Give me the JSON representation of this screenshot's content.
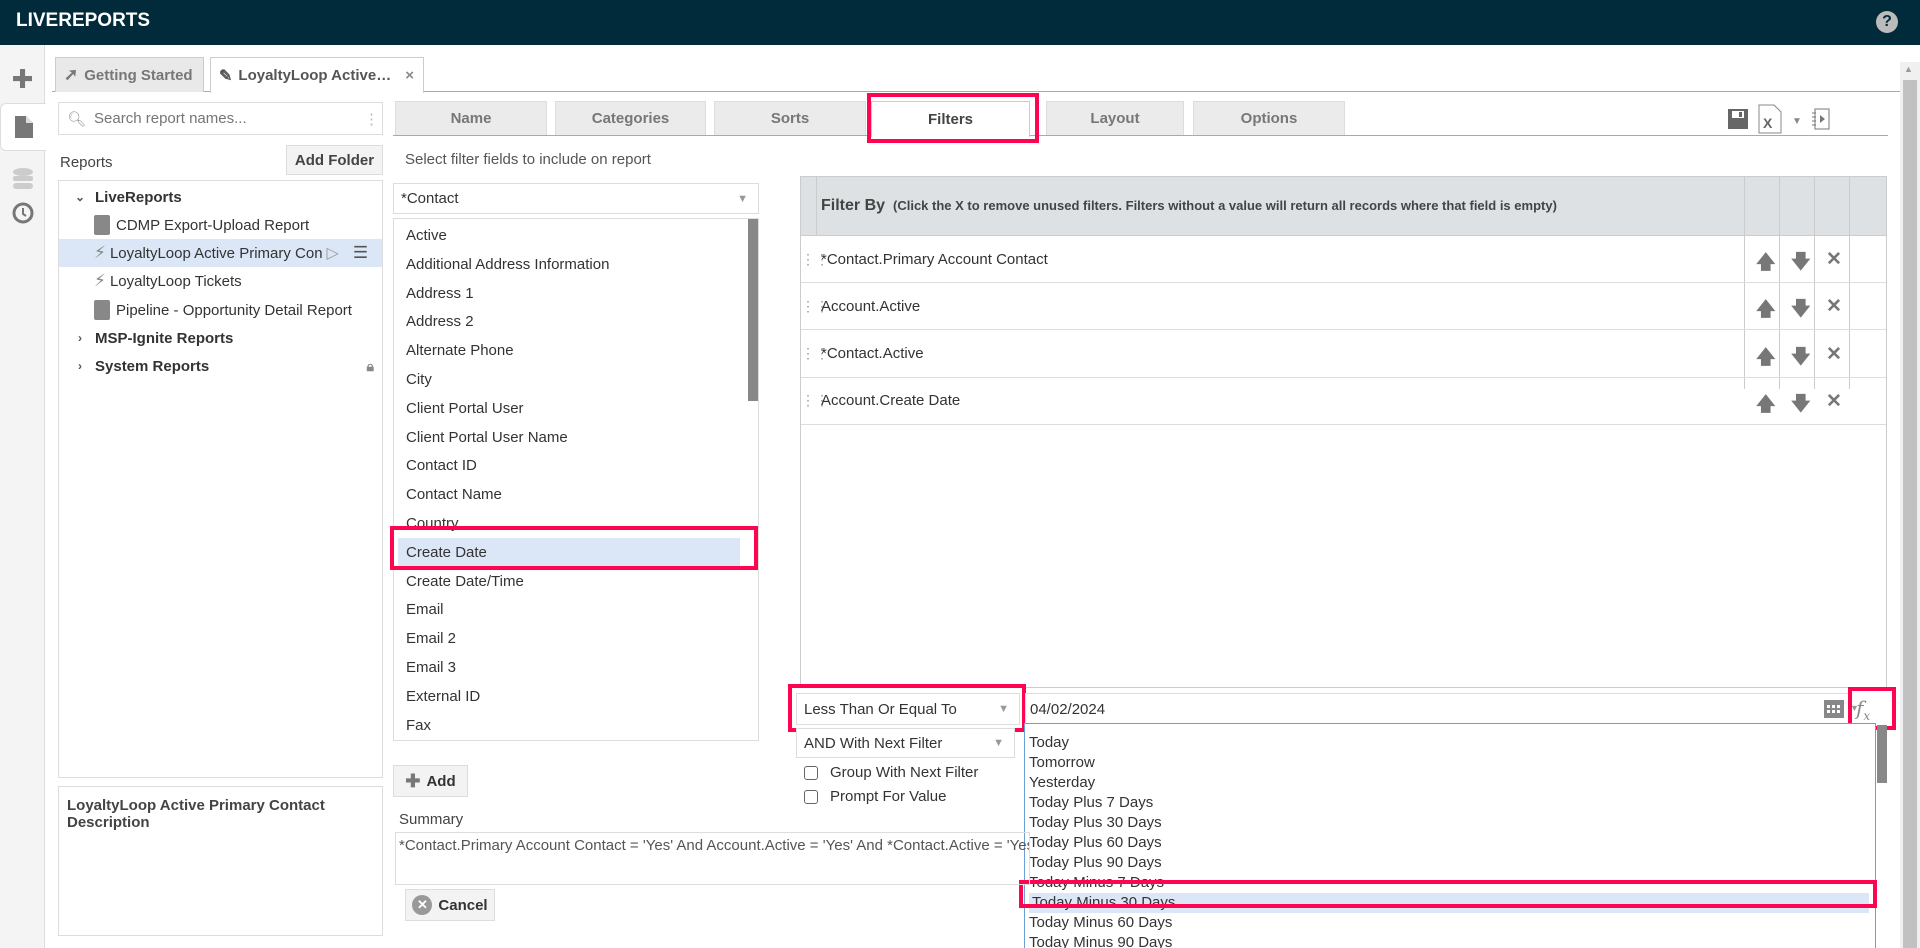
{
  "app": {
    "title": "LIVEREPORTS",
    "help_icon": "question-circle-icon"
  },
  "rail": [
    "plus-icon",
    "document-icon",
    "database-icon",
    "clock-icon"
  ],
  "app_tabs": [
    {
      "label": "Getting Started",
      "icon": "arrow-circle-icon",
      "active": false
    },
    {
      "label": "LoyaltyLoop Active…",
      "icon": "pencil-icon",
      "active": true,
      "close": "×"
    }
  ],
  "sidebar": {
    "search_placeholder": "Search report names...",
    "reports_label": "Reports",
    "add_folder_label": "Add Folder",
    "tree": [
      {
        "label": "LiveReports",
        "type": "folder",
        "expanded": true
      },
      {
        "label": "CDMP Export-Upload Report",
        "type": "report"
      },
      {
        "label": "LoyaltyLoop Active Primary Con",
        "type": "live-report",
        "selected": true
      },
      {
        "label": "LoyaltyLoop Tickets",
        "type": "live-report"
      },
      {
        "label": "Pipeline - Opportunity Detail Report",
        "type": "report"
      },
      {
        "label": "MSP-Ignite Reports",
        "type": "folder",
        "expanded": false
      },
      {
        "label": "System Reports",
        "type": "folder",
        "expanded": false,
        "locked": true
      }
    ],
    "description_title": "LoyaltyLoop Active Primary Contact Description"
  },
  "report_tabs": [
    "Name",
    "Categories",
    "Sorts",
    "Filters",
    "Layout",
    "Options"
  ],
  "active_report_tab": "Filters",
  "filters": {
    "hint": "Select filter fields to include on report",
    "entity_select": "*Contact",
    "fields": [
      "Active",
      "Additional Address Information",
      "Address 1",
      "Address 2",
      "Alternate Phone",
      "City",
      "Client Portal User",
      "Client Portal User Name",
      "Contact ID",
      "Contact Name",
      "Country",
      "Create Date",
      "Create Date/Time",
      "Email",
      "Email 2",
      "Email 3",
      "External ID",
      "Fax"
    ],
    "selected_field": "Create Date",
    "add_label": "Add",
    "table_title": "Filter By",
    "table_subtitle": "(Click the X to remove unused filters. Filters without a value will return all records where that field is empty)",
    "rows": [
      "*Contact.Primary Account Contact",
      "Account.Active",
      "*Contact.Active",
      "Account.Create Date"
    ],
    "operator": "Less Than Or Equal To",
    "conjunction": "AND With Next Filter",
    "group_with_next": "Group With Next Filter",
    "prompt_for_value": "Prompt For Value",
    "date_value": "04/02/2024",
    "date_options": [
      "Today",
      "Tomorrow",
      "Yesterday",
      "Today Plus 7 Days",
      "Today Plus 30 Days",
      "Today Plus 60 Days",
      "Today Plus 90 Days",
      "Today Minus 7 Days",
      "Today Minus 30 Days",
      "Today Minus 60 Days",
      "Today Minus 90 Days"
    ],
    "selected_date_option": "Today Minus 30 Days",
    "summary_label": "Summary",
    "summary_text": "*Contact.Primary Account Contact = 'Yes' And Account.Active = 'Yes' And *Contact.Active = 'Yes'",
    "cancel_label": "Cancel"
  },
  "colors": {
    "topbar": "#012a3a",
    "highlight": "#fe0552",
    "selection": "#dbe7f6"
  }
}
